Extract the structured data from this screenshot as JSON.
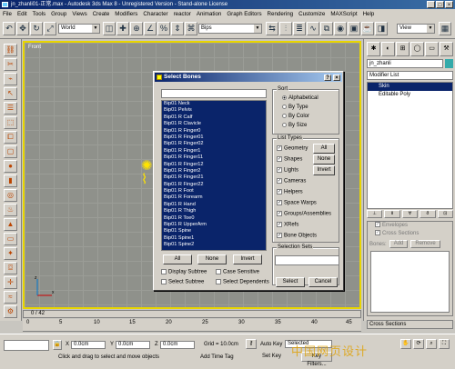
{
  "window": {
    "title": "jn_zhanli01-正常.max - Autodesk 3ds Max 8 - Unregistered Version - Stand-alone License",
    "controls": [
      "_",
      "□",
      "×"
    ]
  },
  "menu": [
    "File",
    "Edit",
    "Tools",
    "Group",
    "Views",
    "Create",
    "Modifiers",
    "Character",
    "reactor",
    "Animation",
    "Graph Editors",
    "Rendering",
    "Customize",
    "MAXScript",
    "Help"
  ],
  "toolbar": {
    "ref_coord": "World",
    "named_sel": "Bips",
    "view_combo": "View"
  },
  "viewport": {
    "label": "Front",
    "border_color": "#e8d500"
  },
  "right_panel": {
    "object_name": "jn_zhanli",
    "modifier_list": "Modifier List",
    "stack_items": [
      "Skin",
      "Editable Poly"
    ],
    "options": [
      "Envelopes",
      "Cross Sections"
    ],
    "bones_label": "Bones:",
    "add_label": "Add",
    "remove_label": "Remove",
    "cross_sections": "Cross Sections"
  },
  "timeline": {
    "frame": "0 / 42",
    "ticks": [
      "0",
      "5",
      "10",
      "15",
      "20",
      "25",
      "30",
      "35",
      "40",
      "45"
    ]
  },
  "status": {
    "x_label": "X",
    "x_val": "0.0cm",
    "y_label": "Y",
    "y_val": "0.0cm",
    "z_label": "Z",
    "z_val": "0.0cm",
    "grid": "Grid = 10.0cm",
    "auto_key": "Auto Key",
    "set_key": "Set Key",
    "selected": "Selected",
    "key_filters": "Key Filters...",
    "prompt": "Click and drag to select and move objects",
    "add_time_tag": "Add Time Tag"
  },
  "watermark": "中国网页设计",
  "dialog": {
    "title": "Select Bones",
    "help_btn": "?",
    "close_btn": "×",
    "bones": [
      "Bip01 Neck",
      "Bip01 Pelvis",
      "Bip01 R Calf",
      "Bip01 R Clavicle",
      "Bip01 R Finger0",
      "Bip01 R Finger01",
      "Bip01 R Finger02",
      "Bip01 R Finger1",
      "Bip01 R Finger11",
      "Bip01 R Finger12",
      "Bip01 R Finger2",
      "Bip01 R Finger21",
      "Bip01 R Finger22",
      "Bip01 R Foot",
      "Bip01 R Forearm",
      "Bip01 R Hand",
      "Bip01 R Thigh",
      "Bip01 R Toe0",
      "Bip01 R UpperArm",
      "Bip01 Spine",
      "Bip01 Spine1",
      "Bip01 Spine2"
    ],
    "sort": {
      "label": "Sort",
      "options": [
        "Alphabetical",
        "By Type",
        "By Color",
        "By Size"
      ],
      "selected": 0
    },
    "list_types": {
      "label": "List Types",
      "items": [
        "Geometry",
        "Shapes",
        "Lights",
        "Cameras",
        "Helpers",
        "Space Warps",
        "Groups/Assemblies",
        "XRefs",
        "Bone Objects"
      ],
      "all_label": "All",
      "none_label": "None",
      "invert_label": "Invert"
    },
    "selection_sets_label": "Selection Sets",
    "all_btn": "All",
    "none_btn": "None",
    "invert_btn": "Invert",
    "display_subtree": "Display Subtree",
    "case_sensitive": "Case Sensitive",
    "select_subtree": "Select Subtree",
    "select_dependents": "Select Dependents",
    "select_btn": "Select",
    "cancel_btn": "Cancel"
  }
}
